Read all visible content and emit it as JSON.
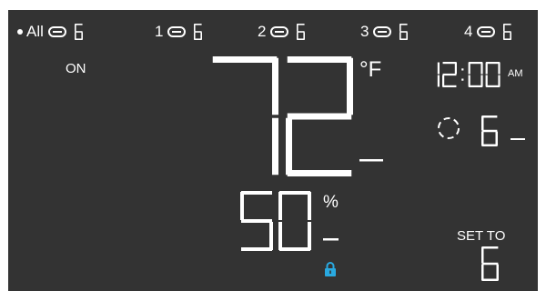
{
  "zones": [
    {
      "label": "All",
      "selected": true,
      "level": "6"
    },
    {
      "label": "1",
      "selected": false,
      "level": "6"
    },
    {
      "label": "2",
      "selected": false,
      "level": "6"
    },
    {
      "label": "3",
      "selected": false,
      "level": "6"
    },
    {
      "label": "4",
      "selected": false,
      "level": "6"
    }
  ],
  "power": {
    "status": "ON"
  },
  "temperature": {
    "value": "72",
    "unit": "°F"
  },
  "clock": {
    "time": "12:00",
    "period": "AM"
  },
  "fan": {
    "icon": "fan-icon",
    "level": "6"
  },
  "humidity": {
    "value": "50",
    "unit": "%"
  },
  "lock": {
    "icon": "lock-icon",
    "color": "#29a9e0"
  },
  "setpoint": {
    "label": "SET TO",
    "value": "6"
  },
  "colors": {
    "screen": "#333333",
    "segment": "#ffffff",
    "accent": "#29a9e0"
  }
}
